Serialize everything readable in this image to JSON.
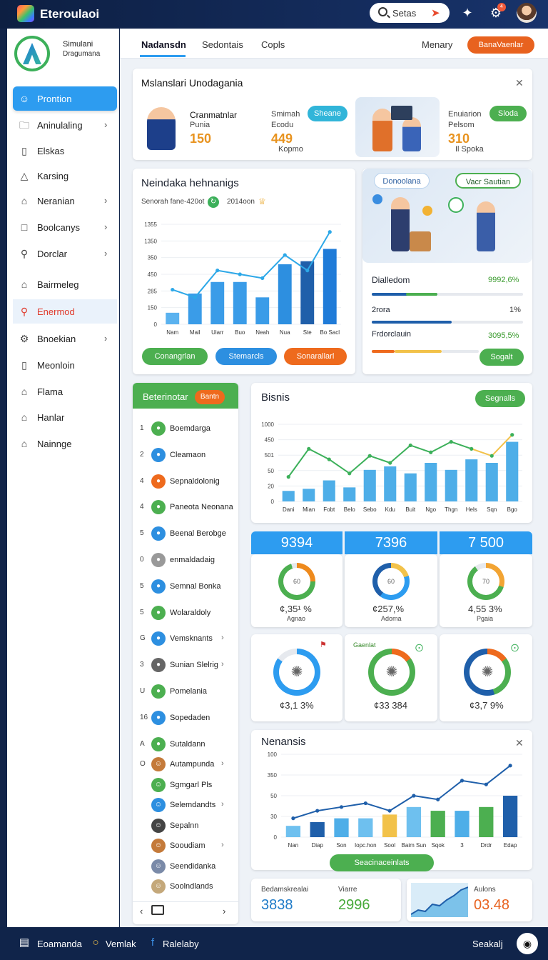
{
  "app": {
    "title": "Eteroulaoi",
    "search": "Setas"
  },
  "sidebar": {
    "brand_line1": "Simulani",
    "brand_line2": "Dragumana",
    "items": [
      {
        "label": "Prontion",
        "icon": "user-icon"
      },
      {
        "label": "Aninulaling",
        "icon": "folder-icon"
      },
      {
        "label": "Elskas",
        "icon": "document-icon"
      },
      {
        "label": "Karsing",
        "icon": "triangle-icon"
      },
      {
        "label": "Neranian",
        "icon": "home-icon"
      },
      {
        "label": "Boolcanys",
        "icon": "folder-icon"
      },
      {
        "label": "Dorclar",
        "icon": "search-icon"
      },
      {
        "label": "Bairmeleg",
        "icon": "home-icon"
      },
      {
        "label": "Enermod",
        "icon": "search-icon"
      },
      {
        "label": "Bnoekian",
        "icon": "gear-icon"
      },
      {
        "label": "Meonloin",
        "icon": "document-icon"
      },
      {
        "label": "Flama",
        "icon": "home-icon"
      },
      {
        "label": "Hanlar",
        "icon": "home-icon"
      },
      {
        "label": "Nainnge",
        "icon": "home-icon"
      }
    ]
  },
  "tabs": [
    {
      "label": "Nadansdn"
    },
    {
      "label": "Sedontais"
    },
    {
      "label": "Copls"
    }
  ],
  "header": {
    "menu": "Menary",
    "button": "BanaVaenlar"
  },
  "top_card": {
    "title": "Mslanslari Unodagania",
    "p1": {
      "name": "Cranmatnlar",
      "sub": "Punia",
      "value": "150"
    },
    "p2": {
      "name": "Smimah",
      "sub": "Ecodu",
      "value": "449",
      "note": "Kopmo",
      "pill": "Sheane"
    },
    "p3": {
      "name": "Enuiarion",
      "sub": "Pelsom",
      "value": "310",
      "note": "Il Spoka",
      "pill": "Sloda"
    }
  },
  "chart1": {
    "title": "Neindaka hehnanigs",
    "meta": "Senorah fane-420ot",
    "meta2": "2014oon",
    "buttons": [
      "Conangrlan",
      "Stemarcls",
      "Sonarallarl"
    ]
  },
  "promo": {
    "pill1": "Donoolana",
    "pill2": "Vacr Sautian",
    "rows": [
      {
        "label": "Dialledom",
        "value": "9992,6%"
      },
      {
        "label": "2rora",
        "value": "1%"
      },
      {
        "label": "Frdorclauin",
        "value": "3095,5%"
      }
    ],
    "button": "Sogalt"
  },
  "list_card": {
    "title": "Beterinotar",
    "badge": "Bantn",
    "items": [
      {
        "num": "1",
        "label": "Boemdarga"
      },
      {
        "num": "2",
        "label": "Cleamaon"
      },
      {
        "num": "4",
        "label": "Sepnaldolonig"
      },
      {
        "num": "4",
        "label": "Paneota Neonana"
      },
      {
        "num": "5",
        "label": "Beenal Berobge"
      },
      {
        "num": "0",
        "label": "enmaldadaig"
      },
      {
        "num": "5",
        "label": "Semnal Bonka"
      },
      {
        "num": "5",
        "label": "Wolaraldoly"
      },
      {
        "num": "G",
        "label": "Vemsknants"
      },
      {
        "num": "3",
        "label": "Sunian Slelrig"
      },
      {
        "num": "U",
        "label": "Pomelania"
      },
      {
        "num": "16",
        "label": "Sopedaden"
      },
      {
        "num": "A",
        "label": "Sutaldann"
      },
      {
        "num": "O",
        "label": "Autampunda"
      },
      {
        "num": "",
        "label": "Sgmgarl Pls"
      },
      {
        "num": "",
        "label": "Selemdandts"
      },
      {
        "num": "",
        "label": "Sepalnn"
      },
      {
        "num": "",
        "label": "Sooudiam"
      },
      {
        "num": "",
        "label": "Seendidanka"
      },
      {
        "num": "",
        "label": "Soolndlands"
      }
    ]
  },
  "chart2": {
    "title": "Bisnis",
    "button": "Segnalls"
  },
  "stats": [
    {
      "head": "9394",
      "pct": "60",
      "value": "¢,35¹ %",
      "sub": "Agnao"
    },
    {
      "head": "7396",
      "pct": "60",
      "value": "¢257,%",
      "sub": "Adoma"
    },
    {
      "head": "7 500",
      "pct": "70",
      "value": "4,55 3%",
      "sub": "Pgaia"
    }
  ],
  "rings": [
    {
      "value": "¢3,1 3%",
      "label": ""
    },
    {
      "value": "¢33 384",
      "label": "Gaenlat"
    },
    {
      "value": "¢3,7 9%",
      "label": ""
    }
  ],
  "chart3": {
    "title": "Nenansis",
    "button": "Seacinaceinlats"
  },
  "bottom_stats": [
    {
      "label": "Bedamskrealai",
      "value": "3838"
    },
    {
      "label": "Viarre",
      "value": "2996"
    },
    {
      "label": "Aulons",
      "value": "03.48"
    }
  ],
  "bottom": {
    "items": [
      "Eoamanda",
      "Vemlak",
      "Ralelaby"
    ],
    "right": "Seakalj"
  },
  "chart_data": [
    {
      "type": "bar",
      "title": "Neindaka hehnanigs",
      "categories": [
        "Nam",
        "Mail",
        "Uiarr",
        "Buo",
        "Neah",
        "Nua",
        "Ste",
        "Bo Sacl"
      ],
      "y_ticks": [
        "0",
        "150",
        "285",
        "450",
        "350",
        "1350",
        "1355"
      ],
      "values": [
        15,
        40,
        55,
        55,
        35,
        78,
        82,
        98
      ],
      "series": [
        {
          "values": [
            15,
            40,
            55,
            55,
            35,
            78,
            82,
            98
          ]
        },
        {
          "values": [
            45,
            35,
            70,
            65,
            60,
            90,
            70,
            120
          ]
        }
      ]
    },
    {
      "type": "bar",
      "title": "Bisnis",
      "categories": [
        "Dani",
        "Mian",
        "Fobt",
        "Belo",
        "Sebo",
        "Kdu",
        "Buit",
        "Ngo",
        "Thgn",
        "Hels",
        "Sqn",
        "Bgo"
      ],
      "y_ticks": [
        "0",
        "20",
        "50",
        "501",
        "450",
        "1000"
      ],
      "series": [
        {
          "values": [
            15,
            18,
            30,
            20,
            45,
            50,
            40,
            55,
            45,
            60,
            55,
            85
          ]
        },
        {
          "values": [
            35,
            75,
            60,
            40,
            65,
            55,
            80,
            70,
            85,
            75,
            65,
            95
          ]
        }
      ]
    },
    {
      "type": "bar",
      "title": "Nenansis",
      "categories": [
        "Nan",
        "Diap",
        "Son",
        "Iopc.hon",
        "Sool",
        "Baim Sun",
        "Sqok",
        "3",
        "Drdr",
        "Edap"
      ],
      "y_ticks": [
        "0",
        "30",
        "50",
        "350",
        "100"
      ],
      "series": [
        {
          "values": [
            15,
            20,
            25,
            25,
            30,
            40,
            35,
            35,
            40,
            55
          ]
        },
        {
          "values": [
            25,
            35,
            40,
            45,
            35,
            55,
            50,
            75,
            70,
            95
          ]
        }
      ]
    }
  ]
}
